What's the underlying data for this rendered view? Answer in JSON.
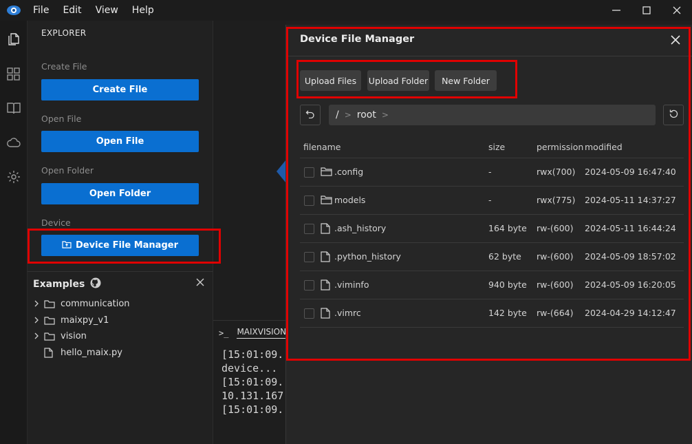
{
  "menubar": {
    "items": [
      "File",
      "Edit",
      "View",
      "Help"
    ]
  },
  "activitybar": {
    "icons": [
      "files-icon",
      "extensions-icon",
      "book-icon",
      "cloud-icon",
      "gear-icon"
    ]
  },
  "sidebar": {
    "title": "EXPLORER",
    "sections": [
      {
        "label": "Create File",
        "button": "Create File"
      },
      {
        "label": "Open File",
        "button": "Open File"
      },
      {
        "label": "Open Folder",
        "button": "Open Folder"
      },
      {
        "label": "Device",
        "button": "Device File Manager"
      }
    ]
  },
  "examples": {
    "title": "Examples",
    "items": [
      {
        "name": "communication",
        "type": "folder"
      },
      {
        "name": "maixpy_v1",
        "type": "folder"
      },
      {
        "name": "vision",
        "type": "folder"
      },
      {
        "name": "hello_maix.py",
        "type": "file"
      }
    ]
  },
  "terminal": {
    "tab": "MAIXVISION",
    "lines": [
      "[15:01:09.",
      "device...",
      "[15:01:09.",
      "10.131.167",
      "[15:01:09."
    ]
  },
  "file_manager": {
    "title": "Device File Manager",
    "toolbar": {
      "upload_files": "Upload Files",
      "upload_folder": "Upload Folder",
      "new_folder": "New Folder"
    },
    "path": {
      "root_sep": "/",
      "segments": [
        "root"
      ]
    },
    "columns": {
      "filename": "filename",
      "size": "size",
      "permission": "permission",
      "modified": "modified"
    },
    "files": [
      {
        "name": ".config",
        "type": "folder",
        "size": "-",
        "permission": "rwx(700)",
        "modified": "2024-05-09 16:47:40"
      },
      {
        "name": "models",
        "type": "folder",
        "size": "-",
        "permission": "rwx(775)",
        "modified": "2024-05-11 14:37:27"
      },
      {
        "name": ".ash_history",
        "type": "file",
        "size": "164 byte",
        "permission": "rw-(600)",
        "modified": "2024-05-11 16:44:24"
      },
      {
        "name": ".python_history",
        "type": "file",
        "size": "62 byte",
        "permission": "rw-(600)",
        "modified": "2024-05-09 18:57:02"
      },
      {
        "name": ".viminfo",
        "type": "file",
        "size": "940 byte",
        "permission": "rw-(600)",
        "modified": "2024-05-09 16:20:05"
      },
      {
        "name": ".vimrc",
        "type": "file",
        "size": "142 byte",
        "permission": "rw-(664)",
        "modified": "2024-04-29 14:12:47"
      }
    ]
  },
  "colors": {
    "accent": "#0a6fd1",
    "highlight": "#e00000",
    "background": "#1f1f1f"
  }
}
